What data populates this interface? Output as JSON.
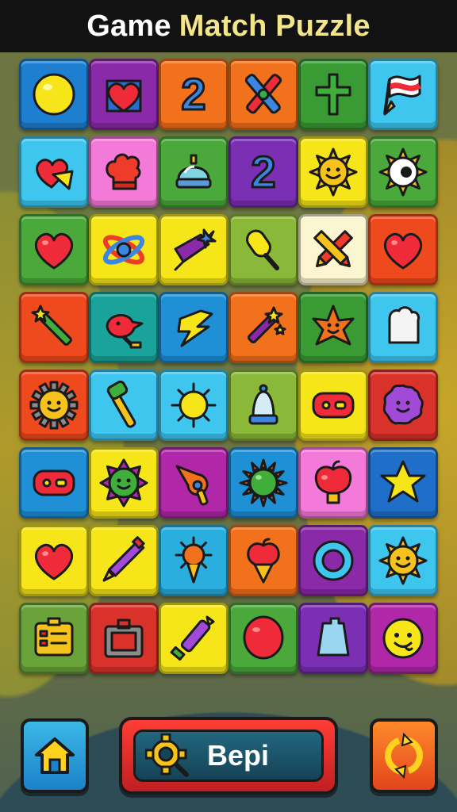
{
  "title": {
    "part1": "Game",
    "part2": "Match Puzzle"
  },
  "colors": {
    "title_white": "#ffffff",
    "title_yellow": "#f3e58a",
    "titlebar_bg": "#121212"
  },
  "board": {
    "rows": 8,
    "cols": 6,
    "tiles": [
      [
        {
          "bg": "#1e7fd0",
          "icon": "yellow-ball"
        },
        {
          "bg": "#8a2aa8",
          "icon": "heart-in-box"
        },
        {
          "bg": "#f2711c",
          "icon": "number-2",
          "text": "2"
        },
        {
          "bg": "#f2711c",
          "icon": "crossed-crayons"
        },
        {
          "bg": "#3a9a34",
          "icon": "green-cross"
        },
        {
          "bg": "#3fc6ef",
          "icon": "flag"
        }
      ],
      [
        {
          "bg": "#3fc6ef",
          "icon": "heart-cheese"
        },
        {
          "bg": "#f47ad9",
          "icon": "chef-hat"
        },
        {
          "bg": "#4ba83a",
          "icon": "crystal-dome"
        },
        {
          "bg": "#7b2fb3",
          "icon": "number-2",
          "text": "2"
        },
        {
          "bg": "#f6e619",
          "icon": "smiling-sun"
        },
        {
          "bg": "#4ba83a",
          "icon": "eyeball-sun"
        }
      ],
      [
        {
          "bg": "#4ba83a",
          "icon": "red-heart"
        },
        {
          "bg": "#f6e619",
          "icon": "atom"
        },
        {
          "bg": "#f6e619",
          "icon": "spinning-top"
        },
        {
          "bg": "#8ab93a",
          "icon": "popsicle"
        },
        {
          "bg": "#fbf6cf",
          "icon": "crossed-pencils"
        },
        {
          "bg": "#ee4a1e",
          "icon": "red-heart"
        }
      ],
      [
        {
          "bg": "#ee4a1e",
          "icon": "magic-wand"
        },
        {
          "bg": "#1aa39a",
          "icon": "red-bird"
        },
        {
          "bg": "#1f8fd6",
          "icon": "yellow-bolt"
        },
        {
          "bg": "#f2711c",
          "icon": "sparkle-wand"
        },
        {
          "bg": "#3a9a34",
          "icon": "star-face"
        },
        {
          "bg": "#3fc6ef",
          "icon": "white-block"
        }
      ],
      [
        {
          "bg": "#ee4a1e",
          "icon": "sun-face"
        },
        {
          "bg": "#3fc6ef",
          "icon": "hammer"
        },
        {
          "bg": "#3fc6ef",
          "icon": "yellow-sun"
        },
        {
          "bg": "#8ab93a",
          "icon": "bell-jar"
        },
        {
          "bg": "#f6e619",
          "icon": "red-pill"
        },
        {
          "bg": "#d8322a",
          "icon": "purple-blob"
        }
      ],
      [
        {
          "bg": "#1f8fd6",
          "icon": "red-pill"
        },
        {
          "bg": "#f6e619",
          "icon": "green-face-flower"
        },
        {
          "bg": "#b028a8",
          "icon": "key-horn"
        },
        {
          "bg": "#1f8fd6",
          "icon": "green-sun"
        },
        {
          "bg": "#f47ad9",
          "icon": "apple-bulb"
        },
        {
          "bg": "#1f6fc8",
          "icon": "yellow-star"
        }
      ],
      [
        {
          "bg": "#f6e619",
          "icon": "red-heart"
        },
        {
          "bg": "#f6e619",
          "icon": "purple-pencil"
        },
        {
          "bg": "#2aaede",
          "icon": "trophy-sun"
        },
        {
          "bg": "#f2711c",
          "icon": "apple-cone"
        },
        {
          "bg": "#8a2aa8",
          "icon": "ring"
        },
        {
          "bg": "#3fc6ef",
          "icon": "smiling-sun"
        }
      ],
      [
        {
          "bg": "#6aa33a",
          "icon": "id-card"
        },
        {
          "bg": "#d8322a",
          "icon": "briefcase"
        },
        {
          "bg": "#f6e619",
          "icon": "purple-crayon"
        },
        {
          "bg": "#4ba83a",
          "icon": "red-balloon"
        },
        {
          "bg": "#7b2fb3",
          "icon": "blue-bag"
        },
        {
          "bg": "#b028a8",
          "icon": "smiley-face"
        }
      ]
    ]
  },
  "footer": {
    "home_icon": "home-icon",
    "center_icon": "gear-search-icon",
    "center_label": "Bepi",
    "refresh_icon": "refresh-icon"
  }
}
